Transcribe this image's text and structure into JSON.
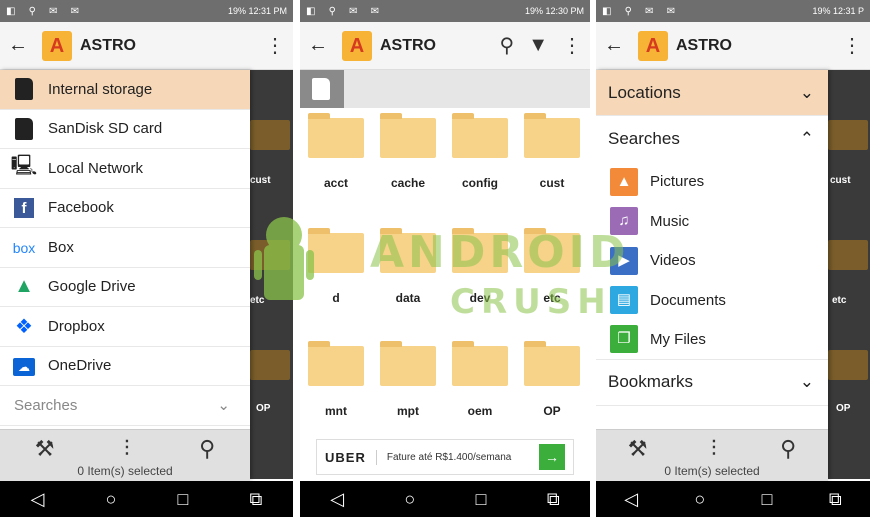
{
  "status": [
    {
      "left": "◧ ⚲ ✉ ✉",
      "right": "19% 12:31 PM"
    },
    {
      "left": "◧ ⚲ ✉ ✉",
      "right": "19% 12:30 PM"
    },
    {
      "left": "◧ ⚲ ✉ ✉",
      "right": "19% 12:31 P"
    }
  ],
  "app": {
    "title": "ASTRO",
    "back": "←",
    "menu": "⋮",
    "search": "🔍",
    "filter": "▼"
  },
  "drawer1": {
    "items": [
      {
        "label": "Internal storage",
        "icon": "phone-storage-icon"
      },
      {
        "label": "SanDisk SD card",
        "icon": "sd-card-icon"
      },
      {
        "label": "Local Network",
        "icon": "network-icon"
      },
      {
        "label": "Facebook",
        "icon": "facebook-icon"
      },
      {
        "label": "Box",
        "icon": "box-icon"
      },
      {
        "label": "Google Drive",
        "icon": "google-drive-icon"
      },
      {
        "label": "Dropbox",
        "icon": "dropbox-icon"
      },
      {
        "label": "OneDrive",
        "icon": "onedrive-icon"
      }
    ],
    "partial_header": "Searches"
  },
  "bottom": {
    "selected_text": "0 Item(s) selected"
  },
  "dim_labels": {
    "cust": "cust",
    "etc": "etc",
    "op": "OP"
  },
  "folders": [
    "acct",
    "cache",
    "config",
    "cust",
    "d",
    "data",
    "dev",
    "etc",
    "mnt",
    "mpt",
    "oem",
    "OP"
  ],
  "ad": {
    "brand": "UBER",
    "text": "Fature até R$1.400/semana",
    "go": "→"
  },
  "drawer3": {
    "locations": "Locations",
    "searches": "Searches",
    "items": [
      {
        "label": "Pictures",
        "icon": "pictures-icon",
        "color": "#f28a3a"
      },
      {
        "label": "Music",
        "icon": "music-icon",
        "color": "#9b6bb5"
      },
      {
        "label": "Videos",
        "icon": "videos-icon",
        "color": "#3b6fc6"
      },
      {
        "label": "Documents",
        "icon": "documents-icon",
        "color": "#2ea8e0"
      },
      {
        "label": "My Files",
        "icon": "my-files-icon",
        "color": "#3cae3c"
      }
    ],
    "bookmarks": "Bookmarks"
  },
  "watermark": {
    "line1": "ANDROID",
    "line2": "CRUSH"
  },
  "colors": {
    "accent": "#f6d8b8",
    "folder": "#f6d389",
    "nav": "#000000"
  }
}
